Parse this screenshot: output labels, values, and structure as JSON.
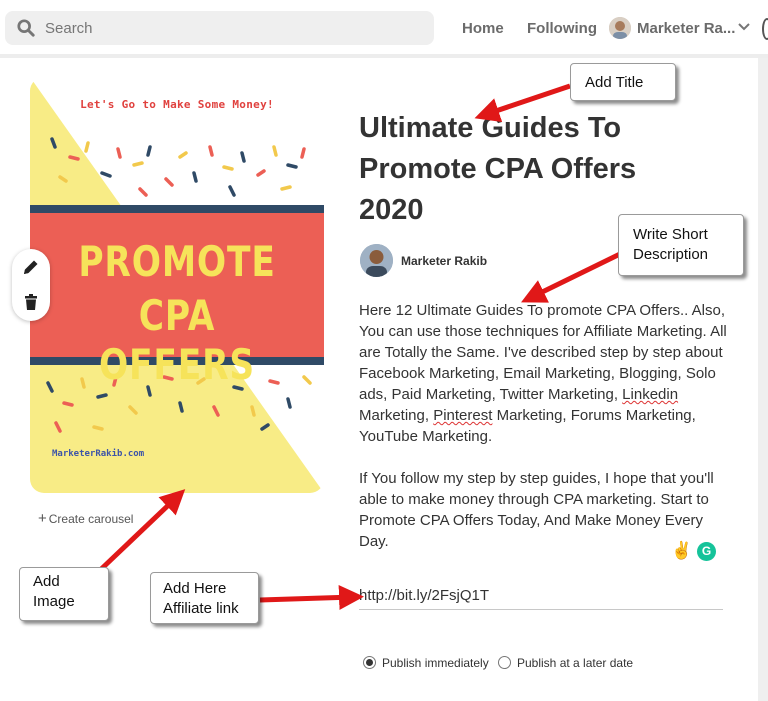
{
  "topbar": {
    "search_placeholder": "Search",
    "nav": {
      "home": "Home",
      "following": "Following",
      "user": "Marketer Ra..."
    }
  },
  "pin_image": {
    "tagline": "Let's Go to Make Some Money!",
    "line1": "PROMOTE",
    "line2": "CPA OFFERS",
    "site": "MarketerRakib.com",
    "colors": {
      "background_yellow": "#f8ec86",
      "banner_red": "#ec5f55",
      "band_navy": "#2f4a66",
      "headline_yellow": "#f6e35a"
    }
  },
  "create_carousel": {
    "icon": "plus-icon",
    "label": "Create carousel"
  },
  "pin": {
    "title": "Ultimate Guides To Promote CPA Offers 2020",
    "author": "Marketer Rakib",
    "description": {
      "p1_before": "Here 12 Ultimate Guides To promote CPA Offers.. Also, You can use those techniques for Affiliate Marketing. All are Totally the Same. I've described step by step about Facebook Marketing, Email Marketing, Blogging, Solo ads, Paid Marketing, Twitter Marketing, ",
      "p1_link1": "Linkedin",
      "p1_mid": " Marketing, ",
      "p1_link2": "Pinterest",
      "p1_after": " Marketing, Forums Marketing, YouTube Marketing.",
      "p2": "If You follow my step by step guides, I hope that you'll able to make money through CPA marketing. Start to Promote CPA Offers Today, And Make Money Every Day."
    },
    "link": "http://bit.ly/2FsjQ1T",
    "publish": {
      "now": "Publish immediately",
      "later": "Publish at a later date",
      "selected": "now"
    }
  },
  "annotations": {
    "title": "Add Title",
    "desc_line1": "Write Short",
    "desc_line2": "Description",
    "image_line1": "Add",
    "image_line2": "Image",
    "link_line1": "Add Here",
    "link_line2": "Affiliate link",
    "arrow_color": "#e01818"
  },
  "icons": {
    "search": "search-icon",
    "edit": "pencil-icon",
    "delete": "trash-icon",
    "chevron": "chevron-down-icon",
    "emoji": "victory-hand-emoji-icon",
    "grammarly": "grammarly-icon"
  }
}
